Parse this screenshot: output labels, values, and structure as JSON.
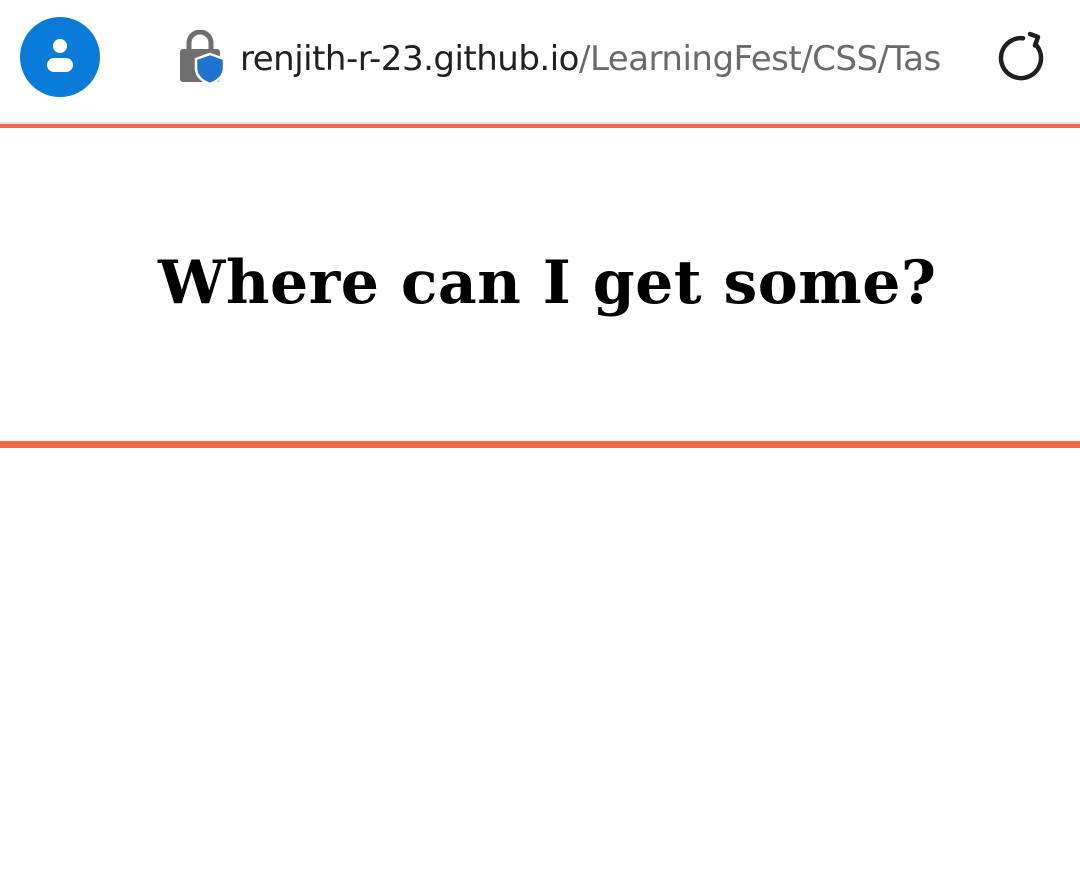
{
  "browser": {
    "url_domain": "renjith-r-23.github.io",
    "url_path": "/LearningFest/CSS/Task",
    "icons": {
      "account": "account-circle-icon",
      "security": "lock-shield-icon",
      "reload": "reload-icon"
    }
  },
  "content": {
    "heading": "Where can I get some?"
  },
  "colors": {
    "accent_rule": "#f0674a",
    "account_blue": "#0a7bd8",
    "url_domain_text": "#202124",
    "url_path_text": "#6b6b6b"
  }
}
